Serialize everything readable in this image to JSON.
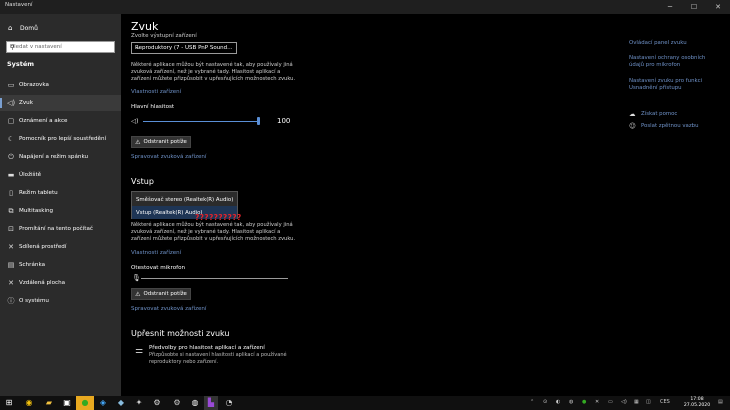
{
  "window": {
    "title": "Nastavení"
  },
  "sidebar": {
    "home": "Domů",
    "search_placeholder": "Hledat v nastavení",
    "section": "Systém",
    "items": [
      {
        "label": "Obrazovka"
      },
      {
        "label": "Zvuk"
      },
      {
        "label": "Oznámení a akce"
      },
      {
        "label": "Pomocník pro lepší soustředění"
      },
      {
        "label": "Napájení a režim spánku"
      },
      {
        "label": "Úložiště"
      },
      {
        "label": "Režim tabletu"
      },
      {
        "label": "Multitasking"
      },
      {
        "label": "Promítání na tento počítač"
      },
      {
        "label": "Sdílená prostředí"
      },
      {
        "label": "Schránka"
      },
      {
        "label": "Vzdálená plocha"
      },
      {
        "label": "O systému"
      }
    ]
  },
  "main": {
    "title": "Zvuk",
    "output": {
      "choose_label": "Zvolte výstupní zařízení",
      "device": "Reproduktory (7 - USB PnP Sound…",
      "info": "Některé aplikace můžou být nastavené tak, aby používaly jiná zvuková zařízení, než je vybrané tady. Hlasitost aplikací a zařízení můžete přizpůsobit v upřesňujících možnostech zvuku.",
      "properties_link": "Vlastnosti zařízení",
      "master_volume_label": "Hlavní hlasitost",
      "volume_value": "100",
      "volume": 1.0,
      "troubleshoot": "Odstranit potíže",
      "manage_link": "Spravovat zvuková zařízení"
    },
    "input": {
      "heading": "Vstup",
      "dropdown_options": [
        "Směšovač stereo (Realtek(R) Audio)",
        "Vstup (Realtek(R) Audio)"
      ],
      "annotation": "??????????",
      "info": "Některé aplikace můžou být nastavené tak, aby používaly jiná zvuková zařízení, než je vybrané tady. Hlasitost aplikací a zařízení můžete přizpůsobit v upřesňujících možnostech zvuku.",
      "properties_link": "Vlastnosti zařízení",
      "test_label": "Otestovat mikrofon",
      "mic_level": 0.0,
      "troubleshoot": "Odstranit potíže",
      "manage_link": "Spravovat zvuková zařízení"
    },
    "advanced": {
      "heading": "Upřesnit možnosti zvuku",
      "prefs_title": "Předvolby pro hlasitost aplikací a zařízení",
      "prefs_desc": "Přizpůsobte si nastavení hlasitosti aplikací a používané reproduktory nebo zařízení."
    }
  },
  "related": {
    "link1": "Ovládací panel zvuku",
    "link2": "Nastavení ochrany osobních údajů pro mikrofon",
    "link3": "Nastavení zvuku pro funkci Usnadnění přístupu",
    "help1": "Získat pomoc",
    "help2": "Poslat zpětnou vazbu"
  },
  "taskbar": {
    "lang": "CES",
    "time": "17:08",
    "date": "27.05.2020"
  }
}
